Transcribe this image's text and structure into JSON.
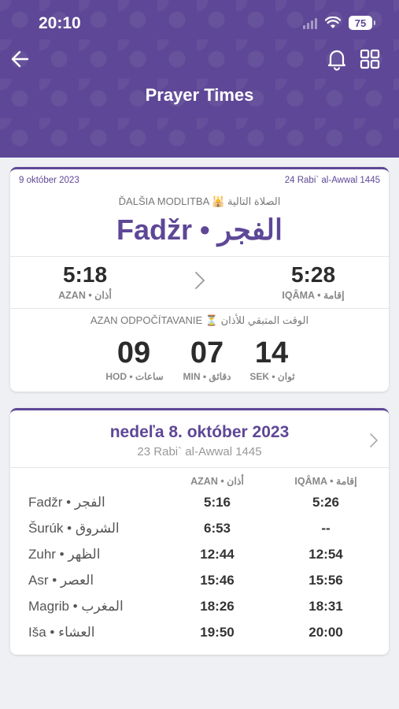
{
  "status_bar": {
    "time": "20:10",
    "battery": "75"
  },
  "header": {
    "title": "Prayer Times"
  },
  "next_card": {
    "gregorian_date": "9 október 2023",
    "hijri_date": "24 Rabi` al-Awwal 1445",
    "next_label": "ĎALŠIA MODLITBA 🕌 الصلاة التالية",
    "next_prayer": "Fadžr • الفجر",
    "azan_time": "5:18",
    "azan_label": "AZAN • أذان",
    "iqama_time": "5:28",
    "iqama_label": "IQÂMA • إقامة",
    "countdown_label": "AZAN ODPOČÍTAVANIE ⏳ الوقت المتبقي للأذان",
    "countdown": {
      "hours": "09",
      "hours_label": "HOD • ساعات",
      "minutes": "07",
      "minutes_label": "MIN • دقائق",
      "seconds": "14",
      "seconds_label": "SEK • ثوان"
    }
  },
  "day_card": {
    "title": "nedeľa 8. október 2023",
    "hijri": "23 Rabi` al-Awwal 1445",
    "col_azan": "AZAN • أذان",
    "col_iqama": "IQÂMA • إقامة",
    "rows": [
      {
        "name": "Fadžr • الفجر",
        "azan": "5:16",
        "iqama": "5:26"
      },
      {
        "name": "Šurúk • الشروق",
        "azan": "6:53",
        "iqama": "--"
      },
      {
        "name": "Zuhr • الظهر",
        "azan": "12:44",
        "iqama": "12:54"
      },
      {
        "name": "Asr • العصر",
        "azan": "15:46",
        "iqama": "15:56"
      },
      {
        "name": "Magrib • المغرب",
        "azan": "18:26",
        "iqama": "18:31"
      },
      {
        "name": "Iša • العشاء",
        "azan": "19:50",
        "iqama": "20:00"
      }
    ]
  },
  "colors": {
    "primary": "#5e4796",
    "background": "#eef0f3"
  },
  "icons": {
    "back": "back-arrow-icon",
    "bell": "bell-icon",
    "grid": "grid-icon",
    "chevron": "chevron-right-icon"
  }
}
